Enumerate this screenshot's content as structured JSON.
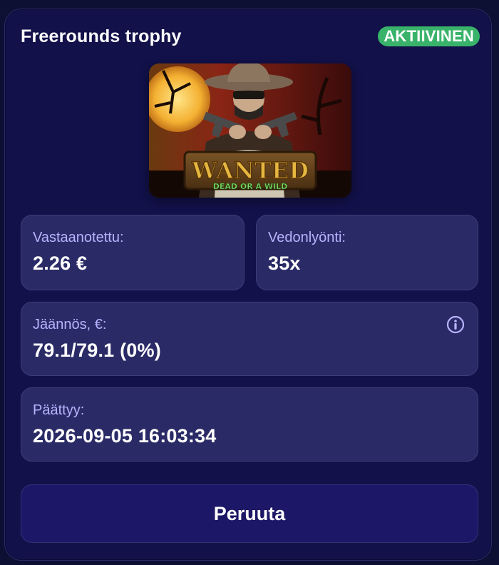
{
  "card": {
    "title": "Freerounds trophy",
    "status": "AKTIIVINEN"
  },
  "game": {
    "image_icon": "game-thumbnail-image",
    "logo_line1": "WANTED",
    "logo_line2": "DEAD OR A WILD"
  },
  "stats": {
    "received": {
      "label": "Vastaanotettu:",
      "value": "2.26 €"
    },
    "wagering": {
      "label": "Vedonlyönti:",
      "value": "35x"
    },
    "remaining": {
      "label": "Jäännös, €:",
      "value": "79.1/79.1 (0%)",
      "icon": "info-icon"
    },
    "expires": {
      "label": "Päättyy:",
      "value": "2026-09-05 16:03:34"
    }
  },
  "actions": {
    "cancel_label": "Peruuta"
  },
  "colors": {
    "background": "#0d0f33",
    "card": "#12114a",
    "tile": "#2a2b66",
    "label": "#b8b3ff",
    "badge": "#39b36a",
    "button": "#1c1766"
  }
}
